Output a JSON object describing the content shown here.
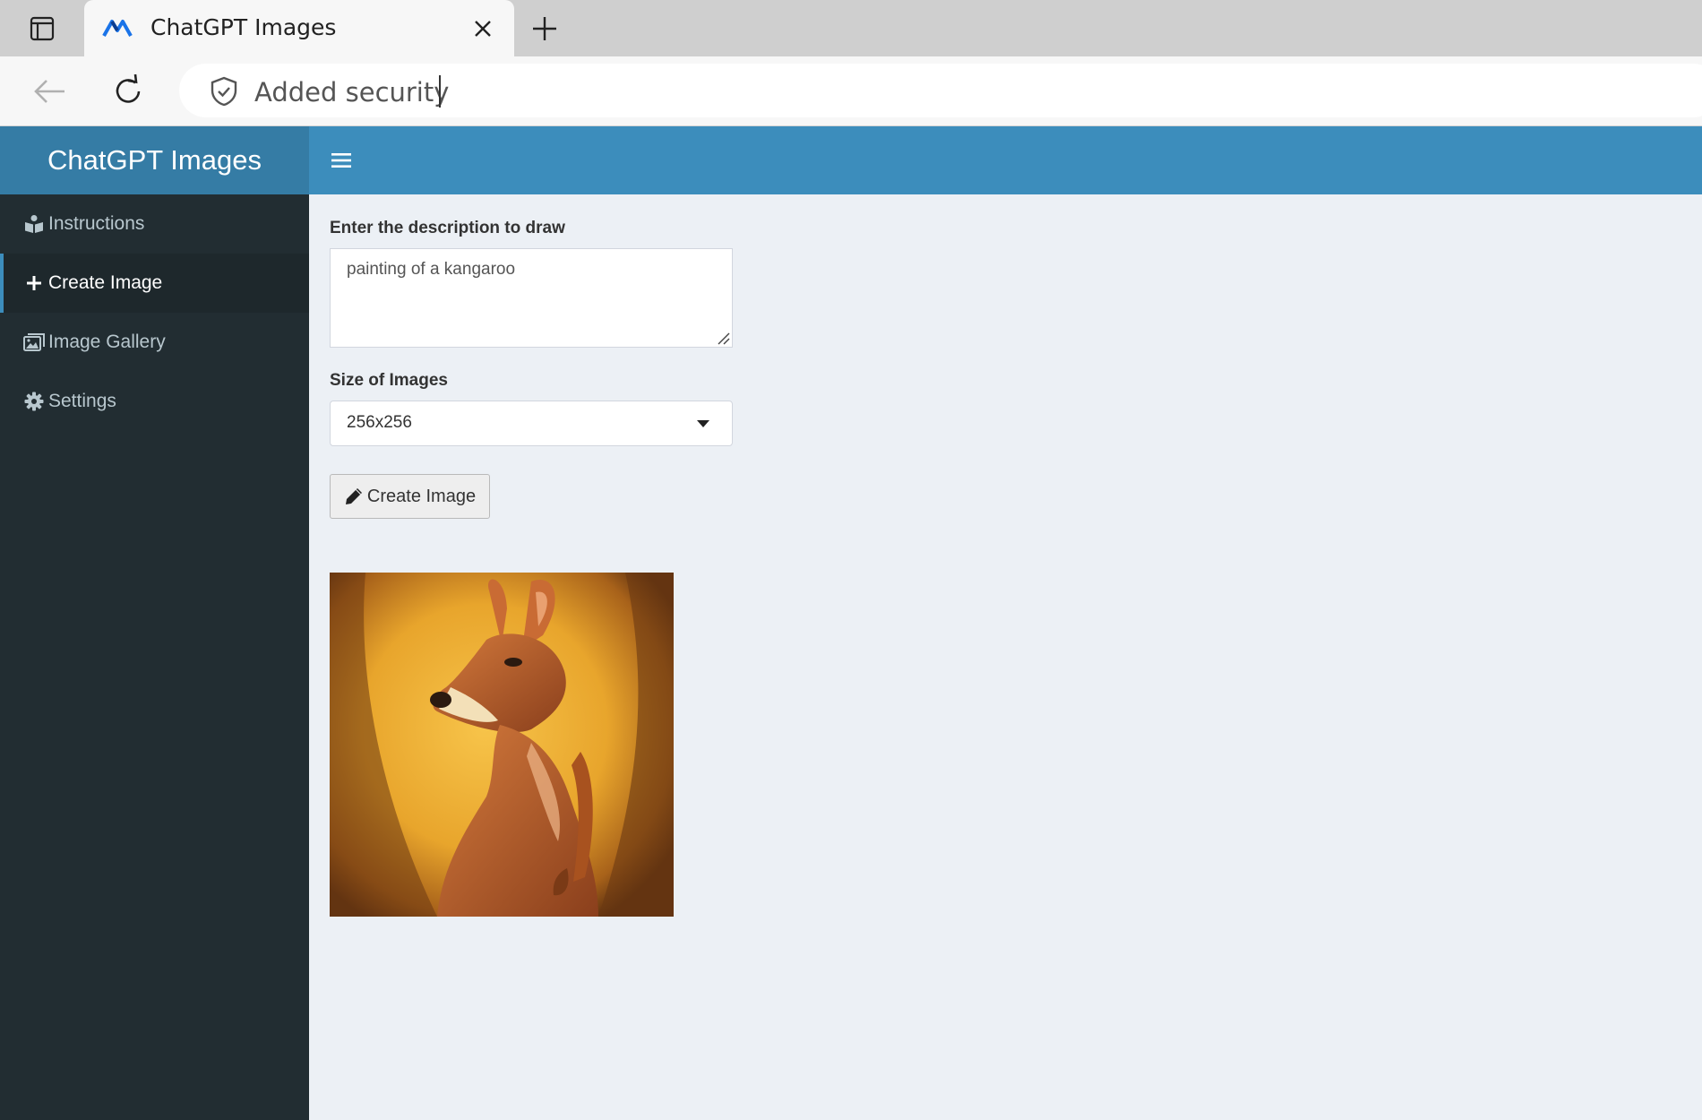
{
  "browser": {
    "tab_title": "ChatGPT Images",
    "address_text": "Added security"
  },
  "app": {
    "title": "ChatGPT Images"
  },
  "sidebar": {
    "items": [
      {
        "label": "Instructions",
        "icon": "book-reader-icon",
        "active": false
      },
      {
        "label": "Create Image",
        "icon": "plus-icon",
        "active": true
      },
      {
        "label": "Image Gallery",
        "icon": "images-icon",
        "active": false
      },
      {
        "label": "Settings",
        "icon": "gear-icon",
        "active": false
      }
    ]
  },
  "form": {
    "description_label": "Enter the description to draw",
    "description_value": "painting of a kangaroo",
    "size_label": "Size of Images",
    "size_value": "256x256",
    "create_button_label": "Create Image"
  },
  "colors": {
    "header_logo": "#357ca5",
    "header_bar": "#3c8dbc",
    "sidebar_bg": "#222d32",
    "content_bg": "#ecf0f5"
  }
}
